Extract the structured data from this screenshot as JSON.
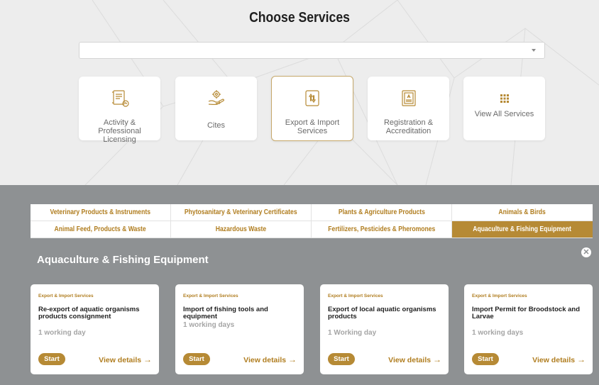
{
  "header": {
    "title": "Choose Services"
  },
  "service_select": {
    "value": ""
  },
  "service_tiles": [
    {
      "label": "Activity & Professional Licensing",
      "icon": "license-document-icon"
    },
    {
      "label": "Cites",
      "icon": "hand-gear-icon"
    },
    {
      "label": "Export & Import Services",
      "icon": "export-import-icon",
      "active": true
    },
    {
      "label": "Registration & Accreditation",
      "icon": "certificate-icon"
    },
    {
      "label": "View All Services",
      "icon": "grid-icon"
    }
  ],
  "tabs": [
    {
      "label": "Veterinary Products & Instruments"
    },
    {
      "label": "Phytosanitary & Veterinary Certificates"
    },
    {
      "label": "Plants & Agriculture Products"
    },
    {
      "label": "Animals & Birds"
    },
    {
      "label": "Animal Feed, Products & Waste"
    },
    {
      "label": "Hazardous Waste"
    },
    {
      "label": "Fertilizers, Pesticides & Pheromones"
    },
    {
      "label": "Aquaculture & Fishing Equipment",
      "selected": true
    }
  ],
  "section": {
    "title": "Aquaculture & Fishing Equipment"
  },
  "cards": [
    {
      "category": "Export & Import Services",
      "name": "Re-export of aquatic organisms products consignment",
      "duration": "1 working day",
      "start_label": "Start",
      "details_label": "View details"
    },
    {
      "category": "Export & Import Services",
      "name": "Import of fishing tools and equipment",
      "duration": "1 working days",
      "start_label": "Start",
      "details_label": "View details"
    },
    {
      "category": "Export & Import Services",
      "name": "Export of local aquatic organisms products",
      "duration": "1 Working day",
      "start_label": "Start",
      "details_label": "View details"
    },
    {
      "category": "Export & Import Services",
      "name": "Import Permit for Broodstock and Larvae",
      "duration": "1 working days",
      "start_label": "Start",
      "details_label": "View details"
    }
  ],
  "colors": {
    "accent": "#b68a35",
    "panel": "#8e9193",
    "top_bg": "#ededed"
  }
}
